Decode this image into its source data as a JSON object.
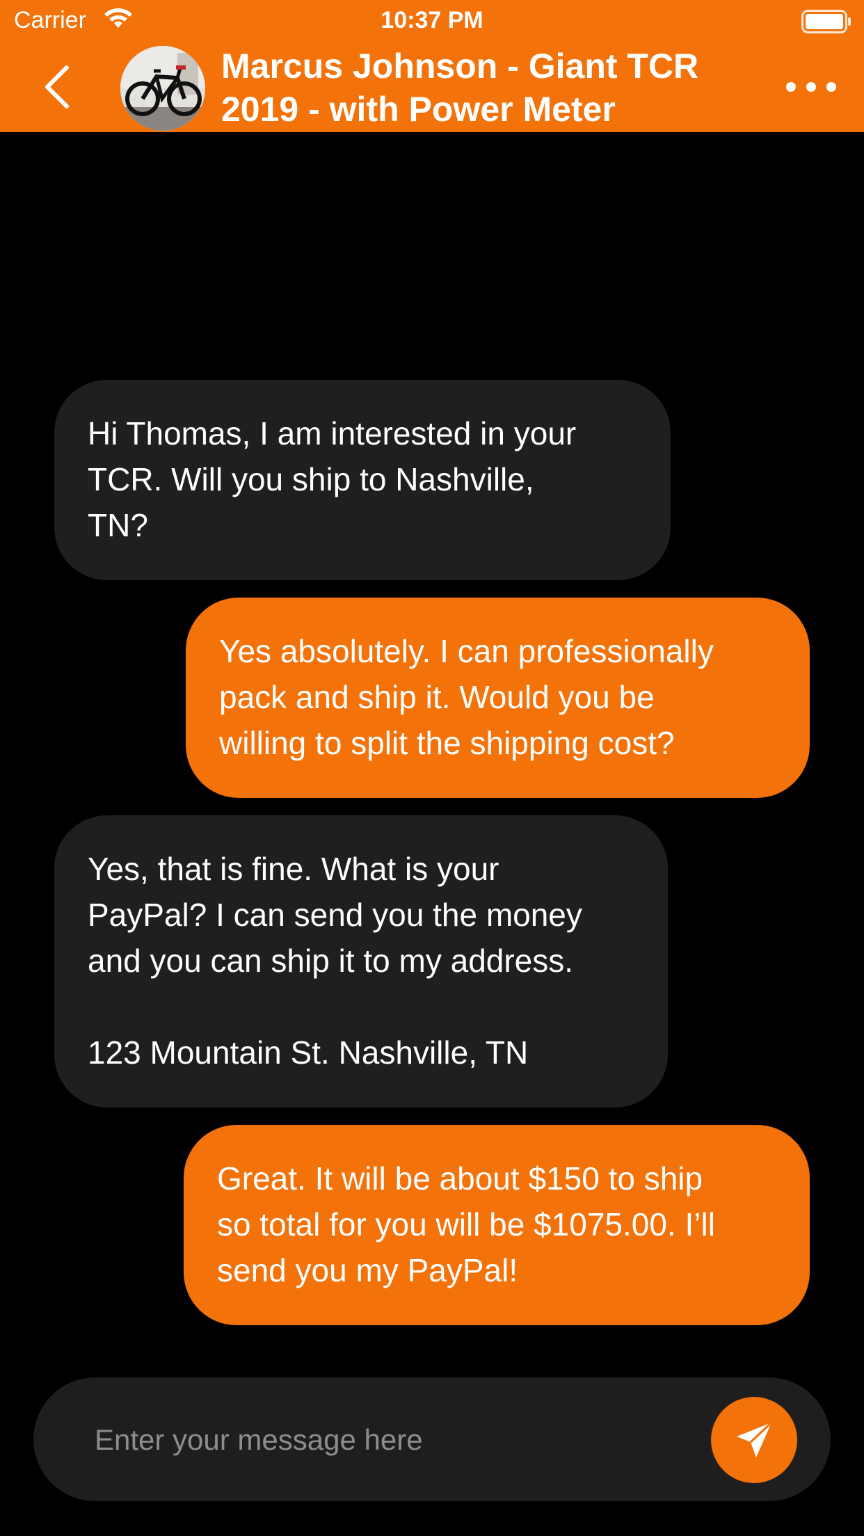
{
  "status_bar": {
    "carrier": "Carrier",
    "time": "10:37 PM"
  },
  "header": {
    "title": "Marcus Johnson - Giant TCR 2019 - with Power Meter",
    "accent_color": "#F37209"
  },
  "messages": [
    {
      "direction": "incoming",
      "text": "Hi Thomas, I am interested in your\nTCR. Will you ship to Nashville,\nTN?"
    },
    {
      "direction": "outgoing",
      "text": "Yes absolutely. I can professionally\npack and ship it. Would you be\nwilling to split the shipping cost?"
    },
    {
      "direction": "incoming",
      "text": "Yes, that is fine. What is your\nPayPal? I can send you the money\nand you can ship it to my address.\n\n123 Mountain St. Nashville, TN"
    },
    {
      "direction": "outgoing",
      "text": "Great. It will be about $150 to ship\nso total for you will be $1075.00. I’ll\nsend you my PayPal!"
    }
  ],
  "composer": {
    "placeholder": "Enter your message here",
    "value": ""
  },
  "icons": {
    "back": "chevron-left-icon",
    "more": "ellipsis-icon",
    "send": "paper-plane-icon",
    "wifi": "wifi-icon",
    "battery": "battery-icon"
  }
}
